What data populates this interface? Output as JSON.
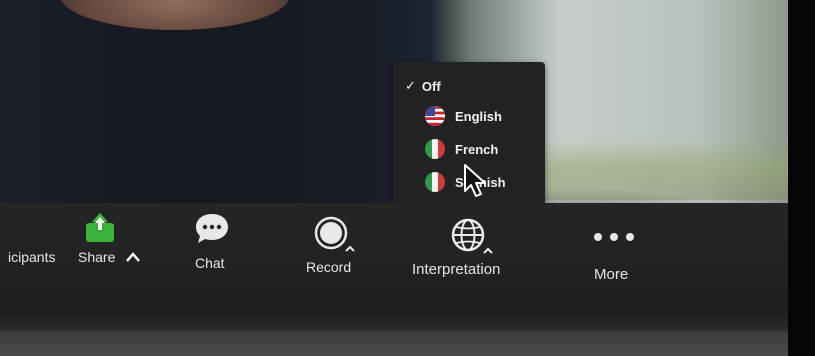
{
  "toolbar": {
    "participants_label": "icipants",
    "share_label": "Share",
    "chat_label": "Chat",
    "record_label": "Record",
    "interpretation_label": "Interpretation",
    "more_label": "More"
  },
  "interpretation_menu": {
    "items": [
      {
        "label": "Off",
        "checked": true,
        "flag": null
      },
      {
        "label": "English",
        "checked": false,
        "flag": "us-flag-icon"
      },
      {
        "label": "French",
        "checked": false,
        "flag": "italy-flag-icon"
      },
      {
        "label": "Spanish",
        "checked": false,
        "flag": "italy-flag-icon"
      }
    ]
  },
  "colors": {
    "share_green": "#3db53d",
    "menu_bg": "#222222",
    "toolbar_bg": "#222222",
    "text": "#e6e6e6"
  }
}
